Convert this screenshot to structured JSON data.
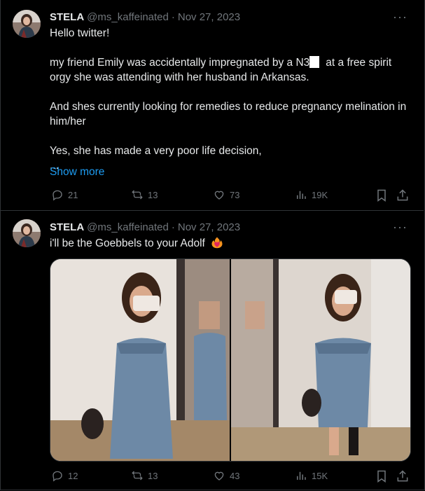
{
  "tweets": [
    {
      "display_name": "STELA",
      "handle": "@ms_kaffeinated",
      "separator": "·",
      "date": "Nov 27, 2023",
      "more_glyph": "···",
      "text_line1": "Hello twitter!",
      "text_line2a": "my friend Emily was accidentally impregnated by a N3",
      "text_line2b": "at a free spirit orgy she was attending with her husband in Arkansas.",
      "text_line3": "And shes currently looking for remedies to reduce pregnancy melination in him/her",
      "text_line4": "Yes, she has made a very poor life decision,",
      "text_line5": "...",
      "show_more": "Show more",
      "replies": "21",
      "reposts": "13",
      "likes": "73",
      "views": "19K"
    },
    {
      "display_name": "STELA",
      "handle": "@ms_kaffeinated",
      "separator": "·",
      "date": "Nov 27, 2023",
      "more_glyph": "···",
      "text": "i'll be the Goebbels to your Adolf",
      "emoji_icon": "heart-on-fire-icon",
      "media_icon": "photo-icon",
      "replies": "12",
      "reposts": "13",
      "likes": "43",
      "views": "15K"
    }
  ],
  "icons": {
    "reply": "reply-icon",
    "repost": "repost-icon",
    "like": "like-icon",
    "views": "views-icon",
    "bookmark": "bookmark-icon",
    "share": "share-icon"
  },
  "colors": {
    "background": "#000000",
    "text": "#e7e9ea",
    "secondary": "#71767b",
    "link": "#1d9bf0",
    "divider": "#2f3336"
  }
}
